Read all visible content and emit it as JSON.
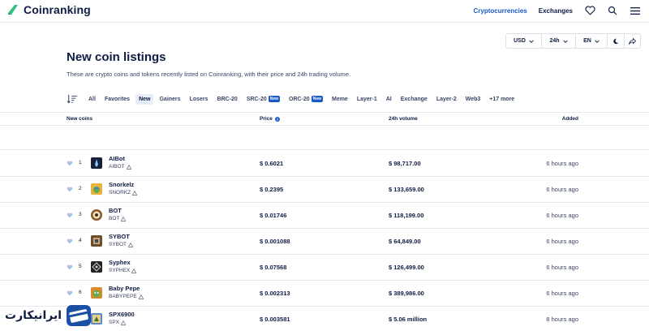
{
  "header": {
    "brand": "Coinranking",
    "nav": [
      {
        "label": "Cryptocurrencies",
        "active": true
      },
      {
        "label": "Exchanges",
        "active": false
      }
    ]
  },
  "controls": {
    "currency": "USD",
    "timeframe": "24h",
    "language": "EN"
  },
  "page": {
    "title": "New coin listings",
    "description": "These are crypto coins and tokens recently listed on Coinranking, with their price and 24h trading volume."
  },
  "filters": [
    {
      "label": "All",
      "active": false,
      "badge": ""
    },
    {
      "label": "Favorites",
      "active": false,
      "badge": ""
    },
    {
      "label": "New",
      "active": true,
      "badge": ""
    },
    {
      "label": "Gainers",
      "active": false,
      "badge": ""
    },
    {
      "label": "Losers",
      "active": false,
      "badge": ""
    },
    {
      "label": "BRC-20",
      "active": false,
      "badge": ""
    },
    {
      "label": "SRC-20",
      "active": false,
      "badge": "New"
    },
    {
      "label": "ORC-20",
      "active": false,
      "badge": "New"
    },
    {
      "label": "Meme",
      "active": false,
      "badge": ""
    },
    {
      "label": "Layer-1",
      "active": false,
      "badge": ""
    },
    {
      "label": "AI",
      "active": false,
      "badge": ""
    },
    {
      "label": "Exchange",
      "active": false,
      "badge": ""
    },
    {
      "label": "Layer-2",
      "active": false,
      "badge": ""
    },
    {
      "label": "Web3",
      "active": false,
      "badge": ""
    },
    {
      "label": "+17 more",
      "active": false,
      "badge": ""
    }
  ],
  "table": {
    "headers": {
      "coins": "New coins",
      "price": "Price",
      "volume": "24h volume",
      "added": "Added"
    },
    "rows": [
      {
        "rank": "1",
        "name": "AIBot",
        "symbol": "AIBOT",
        "price": "$ 0.6021",
        "volume": "$ 98,717.00",
        "added": "6 hours ago",
        "icon_color": "#1a1f3a",
        "icon": "aibot-icon"
      },
      {
        "rank": "2",
        "name": "Snorkelz",
        "symbol": "SNORKZ",
        "price": "$ 0.2395",
        "volume": "$ 133,659.00",
        "added": "6 hours ago",
        "icon_color": "#e6b43c",
        "icon": "snorkelz-icon"
      },
      {
        "rank": "3",
        "name": "BOT",
        "symbol": "BOT",
        "price": "$ 0.01746",
        "volume": "$ 118,199.00",
        "added": "6 hours ago",
        "icon_color": "#8a5a2b",
        "icon": "bot-icon"
      },
      {
        "rank": "4",
        "name": "SYBOT",
        "symbol": "SYBOT",
        "price": "$ 0.001088",
        "volume": "$ 64,849.00",
        "added": "6 hours ago",
        "icon_color": "#6b4e2e",
        "icon": "sybot-icon"
      },
      {
        "rank": "5",
        "name": "Syphex",
        "symbol": "SYPHEX",
        "price": "$ 0.07568",
        "volume": "$ 126,499.00",
        "added": "6 hours ago",
        "icon_color": "#222222",
        "icon": "syphex-icon"
      },
      {
        "rank": "6",
        "name": "Baby Pepe",
        "symbol": "BABYPEPE",
        "price": "$ 0.002313",
        "volume": "$ 389,986.00",
        "added": "6 hours ago",
        "icon_color": "#d98a2a",
        "icon": "babypepe-icon"
      },
      {
        "rank": "",
        "name": "SPX6900",
        "symbol": "SPX",
        "price": "$ 0.003581",
        "volume": "$ 5.06 million",
        "added": "8 hours ago",
        "icon_color": "#5a8ac0",
        "icon": "spx-icon"
      }
    ]
  },
  "watermark": {
    "text": "ایرانیکارت"
  },
  "colors": {
    "accent": "#1b59c9",
    "brand_green": "#2ec27e",
    "text": "#0f1c44",
    "muted": "#3a4466",
    "border": "#e6e9f0"
  }
}
